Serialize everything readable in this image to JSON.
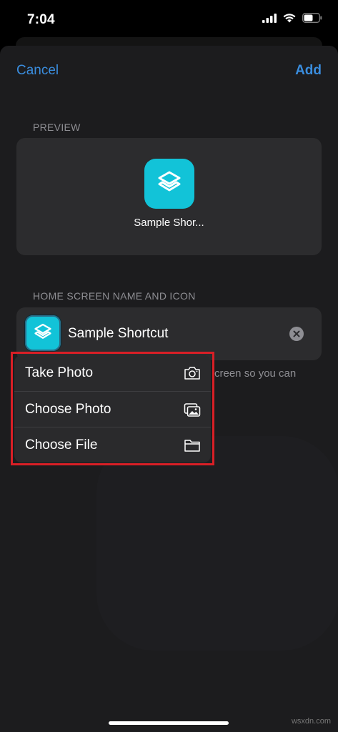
{
  "status_bar": {
    "time": "7:04"
  },
  "nav": {
    "cancel": "Cancel",
    "add": "Add"
  },
  "preview": {
    "section_label": "PREVIEW",
    "name": "Sample Shor..."
  },
  "home_screen": {
    "section_label": "HOME SCREEN NAME AND ICON",
    "name_value": "Sample Shortcut",
    "footer_partial": "creen so you can"
  },
  "icon_menu": {
    "items": [
      {
        "label": "Take Photo",
        "icon": "camera-icon"
      },
      {
        "label": "Choose Photo",
        "icon": "photos-icon"
      },
      {
        "label": "Choose File",
        "icon": "folder-icon"
      }
    ]
  },
  "colors": {
    "accent": "#3a8dde",
    "shortcut_icon": "#12c3d8",
    "highlight": "#d91f26"
  },
  "watermark": "wsxdn.com"
}
